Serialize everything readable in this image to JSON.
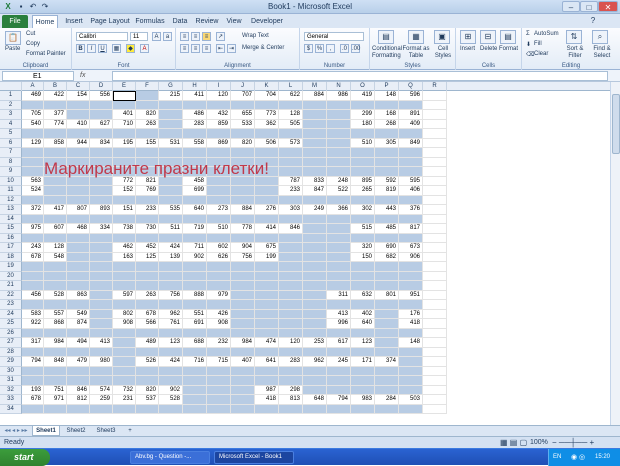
{
  "titlebar": {
    "title": "Book1 - Microsoft Excel"
  },
  "tabs": [
    "File",
    "Home",
    "Insert",
    "Page Layout",
    "Formulas",
    "Data",
    "Review",
    "View",
    "Developer"
  ],
  "ribbon": {
    "clipboard": {
      "paste": "Paste",
      "cut": "Cut",
      "copy": "Copy",
      "format_painter": "Format Painter",
      "label": "Clipboard"
    },
    "font": {
      "name": "Calibri",
      "size": "11",
      "label": "Font"
    },
    "alignment": {
      "wrap": "Wrap Text",
      "merge": "Merge & Center",
      "label": "Alignment"
    },
    "number": {
      "format": "General",
      "label": "Number"
    },
    "styles": {
      "conditional": "Conditional Formatting",
      "format_table": "Format as Table",
      "cell_styles": "Cell Styles",
      "label": "Styles"
    },
    "cells": {
      "insert": "Insert",
      "delete": "Delete",
      "format": "Format",
      "label": "Cells"
    },
    "editing": {
      "autosum": "AutoSum",
      "fill": "Fill",
      "clear": "Clear",
      "sort": "Sort & Filter",
      "find": "Find & Select",
      "label": "Editing"
    }
  },
  "formula_bar": {
    "name_box": "E1",
    "fx": "fx",
    "value": ""
  },
  "columns": [
    "A",
    "B",
    "C",
    "D",
    "E",
    "F",
    "G",
    "H",
    "I",
    "J",
    "K",
    "L",
    "M",
    "N",
    "O",
    "P",
    "Q",
    "R"
  ],
  "overlay_text": "Маркираните празни клетки!",
  "rows": [
    {
      "n": "1",
      "cells": [
        "469",
        "422",
        "154",
        "556",
        "",
        "",
        "215",
        "411",
        "120",
        "707",
        "704",
        "622",
        "884",
        "986",
        "419",
        "148",
        "596",
        ""
      ]
    },
    {
      "n": "2",
      "cells": [
        "",
        "",
        "",
        "",
        "",
        "",
        "",
        "",
        "",
        "",
        "",
        "",
        "",
        "",
        "",
        "",
        "",
        ""
      ]
    },
    {
      "n": "3",
      "cells": [
        "705",
        "377",
        "",
        "",
        "401",
        "820",
        "",
        "486",
        "432",
        "655",
        "773",
        "128",
        "",
        "",
        "299",
        "168",
        "891",
        ""
      ]
    },
    {
      "n": "4",
      "cells": [
        "540",
        "774",
        "410",
        "627",
        "710",
        "263",
        "",
        "283",
        "859",
        "533",
        "362",
        "505",
        "",
        "",
        "180",
        "268",
        "409",
        ""
      ]
    },
    {
      "n": "5",
      "cells": [
        "",
        "",
        "",
        "",
        "",
        "",
        "",
        "",
        "",
        "",
        "",
        "",
        "",
        "",
        "",
        "",
        "",
        ""
      ]
    },
    {
      "n": "6",
      "cells": [
        "129",
        "858",
        "944",
        "834",
        "195",
        "155",
        "531",
        "558",
        "869",
        "820",
        "506",
        "573",
        "",
        "",
        "510",
        "305",
        "849",
        ""
      ]
    },
    {
      "n": "7",
      "cells": [
        "",
        "",
        "",
        "",
        "",
        "",
        "",
        "",
        "",
        "",
        "",
        "",
        "",
        "",
        "",
        "",
        "",
        ""
      ]
    },
    {
      "n": "8",
      "cells": [
        "",
        "",
        "",
        "",
        "",
        "",
        "",
        "",
        "",
        "",
        "",
        "",
        "",
        "",
        "",
        "",
        "",
        ""
      ]
    },
    {
      "n": "9",
      "cells": [
        "",
        "",
        "",
        "",
        "",
        "",
        "",
        "",
        "",
        "",
        "",
        "",
        "",
        "",
        "",
        "",
        "",
        ""
      ]
    },
    {
      "n": "10",
      "cells": [
        "563",
        "",
        "",
        "",
        "772",
        "821",
        "",
        "458",
        "",
        "",
        "",
        "787",
        "833",
        "248",
        "895",
        "592",
        "595",
        ""
      ]
    },
    {
      "n": "11",
      "cells": [
        "524",
        "",
        "",
        "",
        "152",
        "769",
        "",
        "699",
        "",
        "",
        "",
        "233",
        "847",
        "522",
        "265",
        "819",
        "406",
        ""
      ]
    },
    {
      "n": "12",
      "cells": [
        "",
        "",
        "",
        "",
        "",
        "",
        "",
        "",
        "",
        "",
        "",
        "",
        "",
        "",
        "",
        "",
        "",
        ""
      ]
    },
    {
      "n": "13",
      "cells": [
        "372",
        "417",
        "807",
        "893",
        "151",
        "233",
        "535",
        "640",
        "273",
        "884",
        "276",
        "303",
        "249",
        "366",
        "302",
        "443",
        "376",
        ""
      ]
    },
    {
      "n": "14",
      "cells": [
        "",
        "",
        "",
        "",
        "",
        "",
        "",
        "",
        "",
        "",
        "",
        "",
        "",
        "",
        "",
        "",
        "",
        ""
      ]
    },
    {
      "n": "15",
      "cells": [
        "975",
        "607",
        "468",
        "334",
        "738",
        "730",
        "511",
        "719",
        "510",
        "778",
        "414",
        "846",
        "",
        "",
        "515",
        "485",
        "817",
        ""
      ]
    },
    {
      "n": "16",
      "cells": [
        "",
        "",
        "",
        "",
        "",
        "",
        "",
        "",
        "",
        "",
        "",
        "",
        "",
        "",
        "",
        "",
        "",
        ""
      ]
    },
    {
      "n": "17",
      "cells": [
        "243",
        "128",
        "",
        "",
        "462",
        "452",
        "424",
        "711",
        "602",
        "904",
        "675",
        "",
        "",
        "",
        "320",
        "690",
        "673",
        ""
      ]
    },
    {
      "n": "18",
      "cells": [
        "678",
        "548",
        "",
        "",
        "163",
        "125",
        "139",
        "902",
        "626",
        "756",
        "199",
        "",
        "",
        "",
        "150",
        "682",
        "906",
        ""
      ]
    },
    {
      "n": "19",
      "cells": [
        "",
        "",
        "",
        "",
        "",
        "",
        "",
        "",
        "",
        "",
        "",
        "",
        "",
        "",
        "",
        "",
        "",
        ""
      ]
    },
    {
      "n": "20",
      "cells": [
        "",
        "",
        "",
        "",
        "",
        "",
        "",
        "",
        "",
        "",
        "",
        "",
        "",
        "",
        "",
        "",
        "",
        ""
      ]
    },
    {
      "n": "21",
      "cells": [
        "",
        "",
        "",
        "",
        "",
        "",
        "",
        "",
        "",
        "",
        "",
        "",
        "",
        "",
        "",
        "",
        "",
        ""
      ]
    },
    {
      "n": "22",
      "cells": [
        "456",
        "528",
        "863",
        "",
        "597",
        "263",
        "756",
        "888",
        "979",
        "",
        "",
        "",
        "",
        "311",
        "632",
        "801",
        "951",
        ""
      ]
    },
    {
      "n": "23",
      "cells": [
        "",
        "",
        "",
        "",
        "",
        "",
        "",
        "",
        "",
        "",
        "",
        "",
        "",
        "",
        "",
        "",
        "",
        ""
      ]
    },
    {
      "n": "24",
      "cells": [
        "583",
        "557",
        "549",
        "",
        "802",
        "678",
        "962",
        "551",
        "426",
        "",
        "",
        "",
        "",
        "413",
        "402",
        "",
        "176",
        ""
      ]
    },
    {
      "n": "25",
      "cells": [
        "922",
        "868",
        "874",
        "",
        "908",
        "566",
        "761",
        "691",
        "908",
        "",
        "",
        "",
        "",
        "996",
        "640",
        "",
        "418",
        ""
      ]
    },
    {
      "n": "26",
      "cells": [
        "",
        "",
        "",
        "",
        "",
        "",
        "",
        "",
        "",
        "",
        "",
        "",
        "",
        "",
        "",
        "",
        "",
        ""
      ]
    },
    {
      "n": "27",
      "cells": [
        "317",
        "984",
        "494",
        "413",
        "",
        "489",
        "123",
        "688",
        "232",
        "984",
        "474",
        "120",
        "253",
        "617",
        "123",
        "",
        "148",
        ""
      ]
    },
    {
      "n": "28",
      "cells": [
        "",
        "",
        "",
        "",
        "",
        "",
        "",
        "",
        "",
        "",
        "",
        "",
        "",
        "",
        "",
        "",
        "",
        ""
      ]
    },
    {
      "n": "29",
      "cells": [
        "794",
        "848",
        "479",
        "980",
        "",
        "526",
        "424",
        "716",
        "715",
        "407",
        "641",
        "283",
        "962",
        "245",
        "171",
        "374",
        "",
        ""
      ]
    },
    {
      "n": "30",
      "cells": [
        "",
        "",
        "",
        "",
        "",
        "",
        "",
        "",
        "",
        "",
        "",
        "",
        "",
        "",
        "",
        "",
        "",
        ""
      ]
    },
    {
      "n": "31",
      "cells": [
        "",
        "",
        "",
        "",
        "",
        "",
        "",
        "",
        "",
        "",
        "",
        "",
        "",
        "",
        "",
        "",
        "",
        ""
      ]
    },
    {
      "n": "32",
      "cells": [
        "193",
        "751",
        "846",
        "574",
        "732",
        "820",
        "902",
        "",
        "",
        "",
        "987",
        "298",
        "",
        "",
        "",
        "",
        "",
        ""
      ]
    },
    {
      "n": "33",
      "cells": [
        "678",
        "971",
        "812",
        "259",
        "231",
        "537",
        "528",
        "",
        "",
        "",
        "418",
        "813",
        "648",
        "794",
        "983",
        "284",
        "503",
        ""
      ]
    },
    {
      "n": "34",
      "cells": [
        "",
        "",
        "",
        "",
        "",
        "",
        "",
        "",
        "",
        "",
        "",
        "",
        "",
        "",
        "",
        "",
        "",
        ""
      ]
    }
  ],
  "sheet_tabs": [
    "Sheet1",
    "Sheet2",
    "Sheet3"
  ],
  "status": {
    "ready": "Ready",
    "zoom": "100%"
  },
  "taskbar": {
    "start": "start",
    "tasks": [
      "Abv.bg - Question -...",
      "Microsoft Excel - Book1"
    ],
    "lang": "EN",
    "time": "15:20"
  }
}
